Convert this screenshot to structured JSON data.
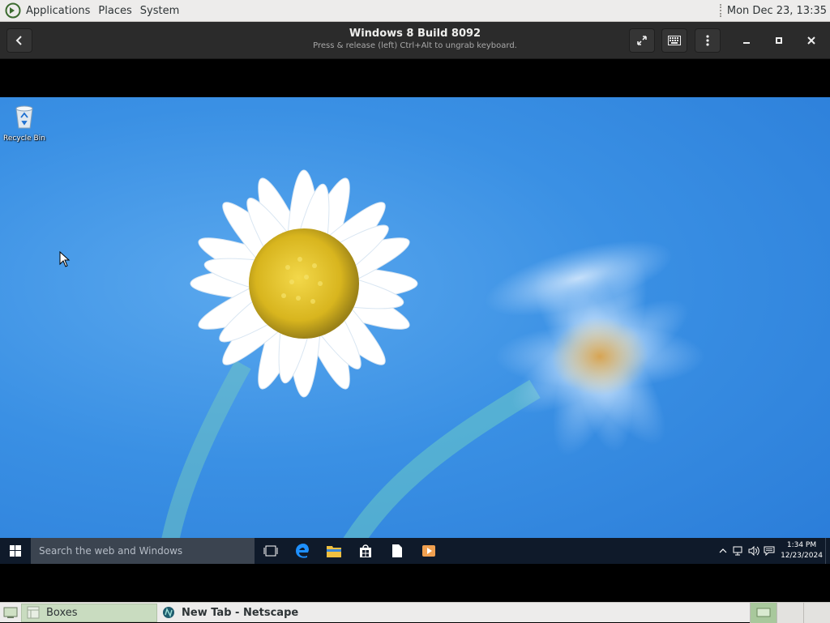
{
  "top_panel": {
    "menus": [
      "Applications",
      "Places",
      "System"
    ],
    "clock": "Mon Dec 23, 13:35"
  },
  "headerbar": {
    "title": "Windows 8 Build 8092",
    "subtitle": "Press & release (left) Ctrl+Alt to ungrab keyboard.",
    "icons": [
      "back-icon",
      "fullscreen-icon",
      "keyboard-icon",
      "kebab-menu-icon",
      "minimize-icon",
      "maximize-icon",
      "close-icon"
    ]
  },
  "guest_desktop": {
    "icons": [
      {
        "label": "Recycle Bin"
      }
    ],
    "taskbar": {
      "search_placeholder": "Search the web and Windows",
      "pinned": [
        "task-view-icon",
        "edge-icon",
        "file-explorer-icon",
        "store-icon",
        "document-icon",
        "media-icon"
      ],
      "tray_icons": [
        "chevron-up-icon",
        "network-icon",
        "volume-icon",
        "action-center-icon"
      ],
      "time": "1:34 PM",
      "date": "12/23/2024"
    },
    "colors": {
      "sky": "#3a90e4",
      "taskbar": "#0f1a2a"
    }
  },
  "bottom_panel": {
    "tasks": [
      {
        "label": "Boxes",
        "active": true
      },
      {
        "label": "New Tab - Netscape",
        "active": false
      }
    ],
    "workspaces": 3
  }
}
